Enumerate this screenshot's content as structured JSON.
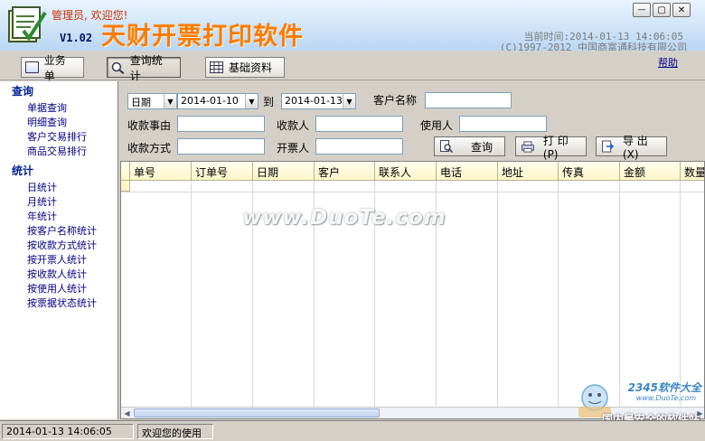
{
  "header": {
    "greeting": "管理员, 欢迎您!",
    "version": "V1.02",
    "app_title": "天财开票打印软件",
    "current_time_label": "当前时间:",
    "current_time": "2014-01-13 14:06:05",
    "copyright": "(C)1997-2012 中国商富通科技有限公司"
  },
  "window_controls": {
    "minimize": "—",
    "maximize": "▢",
    "close": "✕"
  },
  "toolbar": {
    "buttons": [
      {
        "label": "业务单",
        "icon": "document-icon"
      },
      {
        "label": "查询统计",
        "icon": "search-icon"
      },
      {
        "label": "基础资料",
        "icon": "grid-icon"
      }
    ],
    "help": "帮助"
  },
  "sidebar": {
    "query_head": "查询",
    "query_items": [
      "单据查询",
      "明细查询",
      "客户交易排行",
      "商品交易排行"
    ],
    "stat_head": "统计",
    "stat_items": [
      "日统计",
      "月统计",
      "年统计",
      "按客户名称统计",
      "按收款方式统计",
      "按开票人统计",
      "按收款人统计",
      "按使用人统计",
      "按票据状态统计"
    ]
  },
  "filters": {
    "date_type": "日期",
    "date_from": "2014-01-10",
    "to_label": "到",
    "date_to": "2014-01-13",
    "customer_name_label": "客户名称",
    "reason_label": "收款事由",
    "payee_label": "收款人",
    "user_label": "使用人",
    "method_label": "收款方式",
    "issuer_label": "开票人",
    "query_btn": "查询",
    "print_btn": "打 印(P)",
    "export_btn": "导 出(X)"
  },
  "grid": {
    "columns": [
      "单号",
      "订单号",
      "日期",
      "客户",
      "联系人",
      "电话",
      "地址",
      "传真",
      "金额",
      "数量"
    ]
  },
  "watermark": "www.DuoTe.com",
  "corner_brand": {
    "line1": "2345软件大全",
    "line2": "www.DuoTe.com",
    "line3": "国内最安全的软件站"
  },
  "status": {
    "time": "2014-01-13 14:06:05",
    "message": "欢迎您的使用"
  }
}
